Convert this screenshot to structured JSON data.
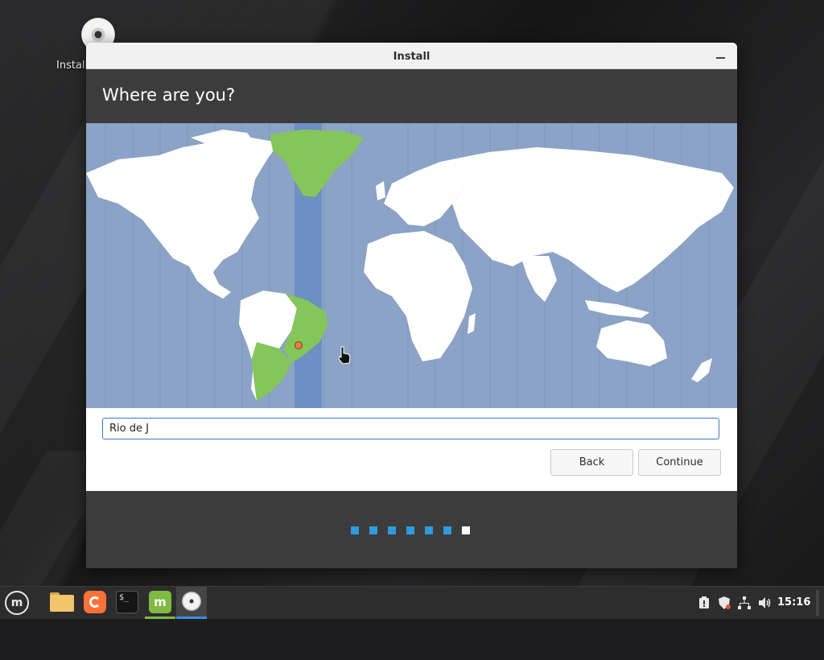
{
  "desktop": {
    "icon_label": "Install"
  },
  "window": {
    "title": "Install",
    "page_title": "Where are you?",
    "timezone_input": {
      "value": "Rio de J",
      "placeholder": ""
    },
    "buttons": {
      "back": "Back",
      "continue": "Continue"
    },
    "progress": {
      "total_steps": 7,
      "current_step": 7,
      "done_color": "#2e9ae0",
      "current_color": "#ffffff"
    }
  },
  "map": {
    "ocean_color": "#8aa3c6",
    "land_color": "#ffffff",
    "selected_region_color": "#84c65a",
    "selected_band_color": "#6d8fc4",
    "selected_city": "Rio de Janeiro"
  },
  "taskbar": {
    "apps": [
      "menu-icon",
      "files-icon",
      "firefox-icon",
      "terminal-icon",
      "software-manager-icon",
      "installer-icon"
    ],
    "clock": "15:16"
  }
}
